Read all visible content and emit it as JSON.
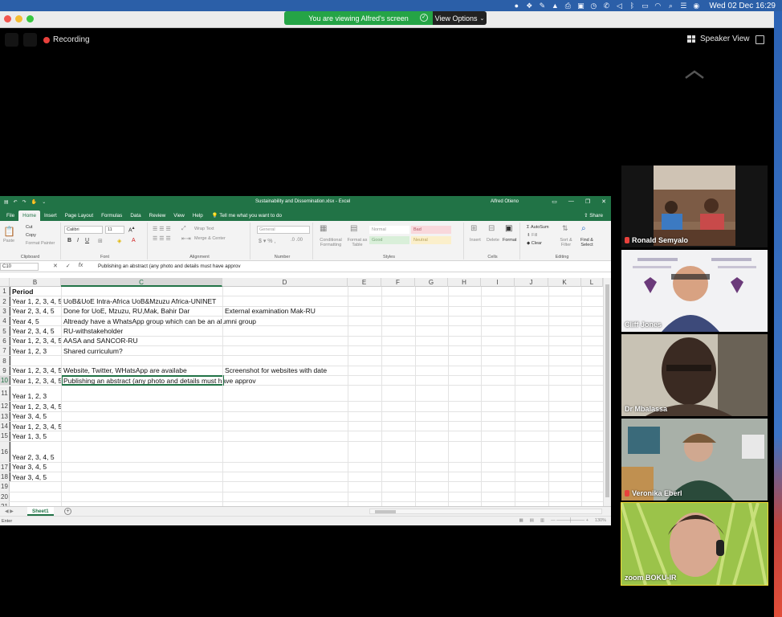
{
  "menubar": {
    "datetime": "Wed 02 Dec  16:29"
  },
  "zoom": {
    "viewing_banner": "You are viewing Alfred's screen",
    "view_options": "View Options",
    "recording_label": "Recording",
    "speaker_view": "Speaker View"
  },
  "excel": {
    "window_title": "Sustainability and Dissemination.xlsx - Excel",
    "user_name": "Alfred Otieno",
    "tabs": [
      {
        "label": "File"
      },
      {
        "label": "Home"
      },
      {
        "label": "Insert"
      },
      {
        "label": "Page Layout"
      },
      {
        "label": "Formulas"
      },
      {
        "label": "Data"
      },
      {
        "label": "Review"
      },
      {
        "label": "View"
      },
      {
        "label": "Help"
      }
    ],
    "tell_me": "Tell me what you want to do",
    "share": "Share",
    "ribbon": {
      "paste": "Paste",
      "cut": "Cut",
      "copy": "Copy",
      "format_painter": "Format Painter",
      "clipboard": "Clipboard",
      "font_name": "Calibri",
      "font_size": "11",
      "font": "Font",
      "wrap_text": "Wrap Text",
      "merge_center": "Merge & Center",
      "alignment": "Alignment",
      "number_format": "General",
      "number": "Number",
      "conditional_formatting": "Conditional Formatting",
      "format_as_table": "Format as Table",
      "style_normal": "Normal",
      "style_bad": "Bad",
      "style_good": "Good",
      "style_neutral": "Neutral",
      "styles": "Styles",
      "insert": "Insert",
      "delete": "Delete",
      "format": "Format",
      "cells": "Cells",
      "autosum": "AutoSum",
      "fill": "Fill",
      "clear": "Clear",
      "sort_filter": "Sort & Filter",
      "find_select": "Find & Select",
      "editing": "Editing"
    },
    "name_box": "C10",
    "formula_text": "Publishing an abstract (any photo and details must have approv",
    "columns": [
      "B",
      "C",
      "D",
      "E",
      "F",
      "G",
      "H",
      "I",
      "J",
      "K",
      "L"
    ],
    "rows": [
      {
        "n": "1",
        "b": "Period",
        "c": "",
        "d": ""
      },
      {
        "n": "2",
        "b": "Year 1, 2, 3, 4, 5",
        "c": "UoB&UoE Intra-Africa UoB&Mzuzu Africa-UNINET",
        "d": ""
      },
      {
        "n": "3",
        "b": "Year 2, 3, 4, 5",
        "c": "Done for UoE, Mzuzu, RU,Mak, Bahir Dar",
        "d": "External examination Mak-RU"
      },
      {
        "n": "4",
        "b": "Year 4, 5",
        "c": "Altready have a WhatsApp group which can be an alumni group",
        "d": ""
      },
      {
        "n": "5",
        "b": "Year 2, 3, 4, 5",
        "c": "RU-withstakeholder",
        "d": ""
      },
      {
        "n": "6",
        "b": "Year 1, 2, 3, 4, 5",
        "c": "AASA and SANCOR-RU",
        "d": ""
      },
      {
        "n": "7",
        "b": "Year 1, 2, 3",
        "c": "Shared curriculum?",
        "d": ""
      },
      {
        "n": "8",
        "b": "",
        "c": "",
        "d": ""
      },
      {
        "n": "9",
        "b": "Year 1, 2, 3, 4, 5",
        "c": "Website, Twitter, WHatsApp are availabe",
        "d": "Screenshot for websites with date"
      },
      {
        "n": "10",
        "b": "Year 1, 2, 3, 4, 5",
        "c": "Publishing an abstract (any photo and details must have approv",
        "d": ""
      },
      {
        "n": "11",
        "b": "Year 1, 2, 3",
        "c": "",
        "d": ""
      },
      {
        "n": "12",
        "b": "Year 1, 2, 3, 4, 5",
        "c": "",
        "d": ""
      },
      {
        "n": "13",
        "b": "Year 3, 4, 5",
        "c": "",
        "d": ""
      },
      {
        "n": "14",
        "b": "Year 1, 2, 3, 4, 5",
        "c": "",
        "d": ""
      },
      {
        "n": "15",
        "b": "Year 1, 3, 5",
        "c": "",
        "d": ""
      },
      {
        "n": "16",
        "b": "Year 2, 3, 4, 5",
        "c": "",
        "d": ""
      },
      {
        "n": "17",
        "b": "Year 3, 4, 5",
        "c": "",
        "d": ""
      },
      {
        "n": "18",
        "b": "Year 3, 4, 5",
        "c": "",
        "d": ""
      },
      {
        "n": "19",
        "b": "",
        "c": "",
        "d": ""
      },
      {
        "n": "20",
        "b": "",
        "c": "",
        "d": ""
      },
      {
        "n": "21",
        "b": "",
        "c": "",
        "d": ""
      }
    ],
    "sheet_tab": "Sheet1",
    "status_mode": "Enter",
    "zoom_level": "130%"
  },
  "participants": [
    {
      "name": "Ronald Semyalo",
      "muted": true
    },
    {
      "name": "Cliff Jones",
      "muted": false
    },
    {
      "name": "Dr Mbalassa",
      "muted": false
    },
    {
      "name": "Veronika Eberl",
      "muted": true
    },
    {
      "name": "zoom BOKU-IR",
      "muted": false
    }
  ]
}
